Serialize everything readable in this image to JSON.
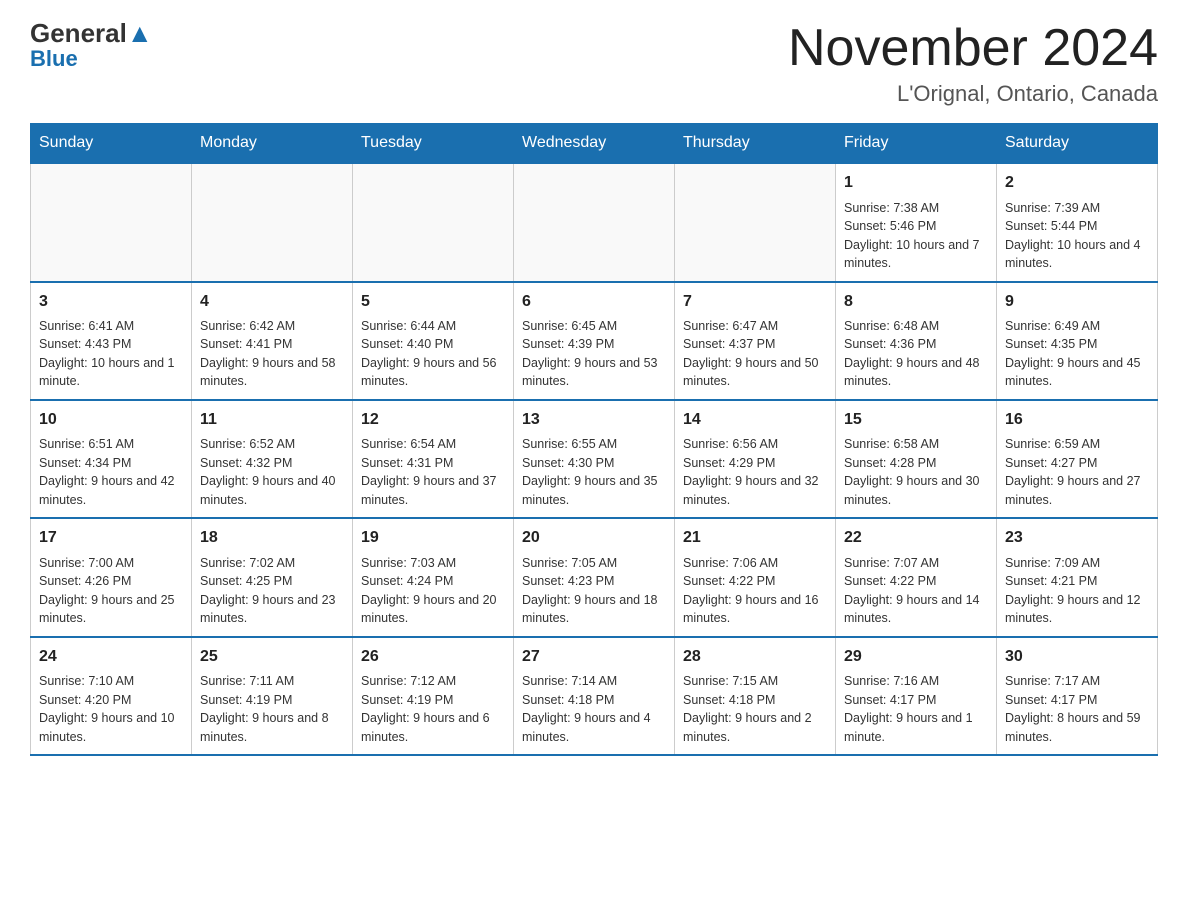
{
  "header": {
    "logo_general": "General",
    "logo_blue": "Blue",
    "month_year": "November 2024",
    "location": "L'Orignal, Ontario, Canada"
  },
  "days_of_week": [
    "Sunday",
    "Monday",
    "Tuesday",
    "Wednesday",
    "Thursday",
    "Friday",
    "Saturday"
  ],
  "weeks": [
    [
      {
        "day": "",
        "sunrise": "",
        "sunset": "",
        "daylight": ""
      },
      {
        "day": "",
        "sunrise": "",
        "sunset": "",
        "daylight": ""
      },
      {
        "day": "",
        "sunrise": "",
        "sunset": "",
        "daylight": ""
      },
      {
        "day": "",
        "sunrise": "",
        "sunset": "",
        "daylight": ""
      },
      {
        "day": "",
        "sunrise": "",
        "sunset": "",
        "daylight": ""
      },
      {
        "day": "1",
        "sunrise": "Sunrise: 7:38 AM",
        "sunset": "Sunset: 5:46 PM",
        "daylight": "Daylight: 10 hours and 7 minutes."
      },
      {
        "day": "2",
        "sunrise": "Sunrise: 7:39 AM",
        "sunset": "Sunset: 5:44 PM",
        "daylight": "Daylight: 10 hours and 4 minutes."
      }
    ],
    [
      {
        "day": "3",
        "sunrise": "Sunrise: 6:41 AM",
        "sunset": "Sunset: 4:43 PM",
        "daylight": "Daylight: 10 hours and 1 minute."
      },
      {
        "day": "4",
        "sunrise": "Sunrise: 6:42 AM",
        "sunset": "Sunset: 4:41 PM",
        "daylight": "Daylight: 9 hours and 58 minutes."
      },
      {
        "day": "5",
        "sunrise": "Sunrise: 6:44 AM",
        "sunset": "Sunset: 4:40 PM",
        "daylight": "Daylight: 9 hours and 56 minutes."
      },
      {
        "day": "6",
        "sunrise": "Sunrise: 6:45 AM",
        "sunset": "Sunset: 4:39 PM",
        "daylight": "Daylight: 9 hours and 53 minutes."
      },
      {
        "day": "7",
        "sunrise": "Sunrise: 6:47 AM",
        "sunset": "Sunset: 4:37 PM",
        "daylight": "Daylight: 9 hours and 50 minutes."
      },
      {
        "day": "8",
        "sunrise": "Sunrise: 6:48 AM",
        "sunset": "Sunset: 4:36 PM",
        "daylight": "Daylight: 9 hours and 48 minutes."
      },
      {
        "day": "9",
        "sunrise": "Sunrise: 6:49 AM",
        "sunset": "Sunset: 4:35 PM",
        "daylight": "Daylight: 9 hours and 45 minutes."
      }
    ],
    [
      {
        "day": "10",
        "sunrise": "Sunrise: 6:51 AM",
        "sunset": "Sunset: 4:34 PM",
        "daylight": "Daylight: 9 hours and 42 minutes."
      },
      {
        "day": "11",
        "sunrise": "Sunrise: 6:52 AM",
        "sunset": "Sunset: 4:32 PM",
        "daylight": "Daylight: 9 hours and 40 minutes."
      },
      {
        "day": "12",
        "sunrise": "Sunrise: 6:54 AM",
        "sunset": "Sunset: 4:31 PM",
        "daylight": "Daylight: 9 hours and 37 minutes."
      },
      {
        "day": "13",
        "sunrise": "Sunrise: 6:55 AM",
        "sunset": "Sunset: 4:30 PM",
        "daylight": "Daylight: 9 hours and 35 minutes."
      },
      {
        "day": "14",
        "sunrise": "Sunrise: 6:56 AM",
        "sunset": "Sunset: 4:29 PM",
        "daylight": "Daylight: 9 hours and 32 minutes."
      },
      {
        "day": "15",
        "sunrise": "Sunrise: 6:58 AM",
        "sunset": "Sunset: 4:28 PM",
        "daylight": "Daylight: 9 hours and 30 minutes."
      },
      {
        "day": "16",
        "sunrise": "Sunrise: 6:59 AM",
        "sunset": "Sunset: 4:27 PM",
        "daylight": "Daylight: 9 hours and 27 minutes."
      }
    ],
    [
      {
        "day": "17",
        "sunrise": "Sunrise: 7:00 AM",
        "sunset": "Sunset: 4:26 PM",
        "daylight": "Daylight: 9 hours and 25 minutes."
      },
      {
        "day": "18",
        "sunrise": "Sunrise: 7:02 AM",
        "sunset": "Sunset: 4:25 PM",
        "daylight": "Daylight: 9 hours and 23 minutes."
      },
      {
        "day": "19",
        "sunrise": "Sunrise: 7:03 AM",
        "sunset": "Sunset: 4:24 PM",
        "daylight": "Daylight: 9 hours and 20 minutes."
      },
      {
        "day": "20",
        "sunrise": "Sunrise: 7:05 AM",
        "sunset": "Sunset: 4:23 PM",
        "daylight": "Daylight: 9 hours and 18 minutes."
      },
      {
        "day": "21",
        "sunrise": "Sunrise: 7:06 AM",
        "sunset": "Sunset: 4:22 PM",
        "daylight": "Daylight: 9 hours and 16 minutes."
      },
      {
        "day": "22",
        "sunrise": "Sunrise: 7:07 AM",
        "sunset": "Sunset: 4:22 PM",
        "daylight": "Daylight: 9 hours and 14 minutes."
      },
      {
        "day": "23",
        "sunrise": "Sunrise: 7:09 AM",
        "sunset": "Sunset: 4:21 PM",
        "daylight": "Daylight: 9 hours and 12 minutes."
      }
    ],
    [
      {
        "day": "24",
        "sunrise": "Sunrise: 7:10 AM",
        "sunset": "Sunset: 4:20 PM",
        "daylight": "Daylight: 9 hours and 10 minutes."
      },
      {
        "day": "25",
        "sunrise": "Sunrise: 7:11 AM",
        "sunset": "Sunset: 4:19 PM",
        "daylight": "Daylight: 9 hours and 8 minutes."
      },
      {
        "day": "26",
        "sunrise": "Sunrise: 7:12 AM",
        "sunset": "Sunset: 4:19 PM",
        "daylight": "Daylight: 9 hours and 6 minutes."
      },
      {
        "day": "27",
        "sunrise": "Sunrise: 7:14 AM",
        "sunset": "Sunset: 4:18 PM",
        "daylight": "Daylight: 9 hours and 4 minutes."
      },
      {
        "day": "28",
        "sunrise": "Sunrise: 7:15 AM",
        "sunset": "Sunset: 4:18 PM",
        "daylight": "Daylight: 9 hours and 2 minutes."
      },
      {
        "day": "29",
        "sunrise": "Sunrise: 7:16 AM",
        "sunset": "Sunset: 4:17 PM",
        "daylight": "Daylight: 9 hours and 1 minute."
      },
      {
        "day": "30",
        "sunrise": "Sunrise: 7:17 AM",
        "sunset": "Sunset: 4:17 PM",
        "daylight": "Daylight: 8 hours and 59 minutes."
      }
    ]
  ]
}
